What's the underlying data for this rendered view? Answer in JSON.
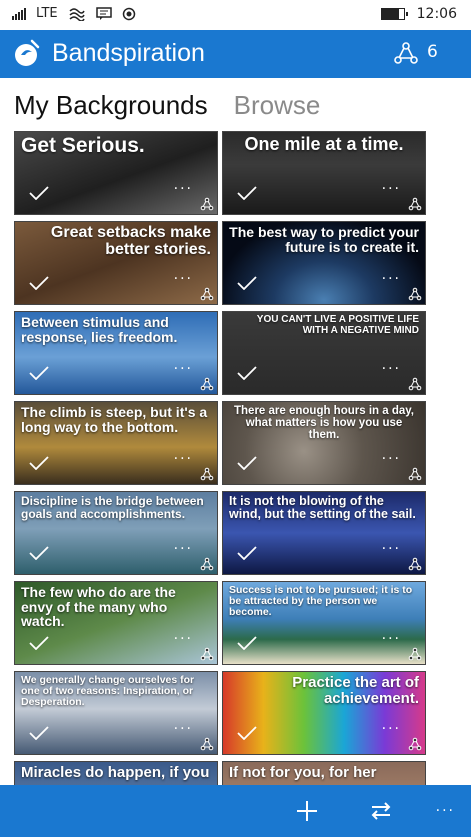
{
  "status_bar": {
    "network": "LTE",
    "time": "12:06",
    "battery_level": 0.8,
    "icons": [
      "signal-icon",
      "lte-label",
      "wifi-icon",
      "message-icon",
      "record-icon",
      "battery-icon"
    ]
  },
  "app_bar": {
    "title": "Bandspiration",
    "shared_count": "6",
    "accent": "#1a78d0"
  },
  "tabs": [
    {
      "label": "My Backgrounds",
      "active": true
    },
    {
      "label": "Browse",
      "active": false
    }
  ],
  "backgrounds": [
    {
      "quote": "Get Serious.",
      "bg": "linear-gradient(160deg,#4a4a4a 0%,#1f1f1f 55%,#6a6a6a 100%)",
      "align": "left",
      "size": 21
    },
    {
      "quote": "One mile at a time.",
      "bg": "linear-gradient(180deg,#2b2b2b 0%,#3b3b3b 40%,#1a1a1a 100%)",
      "align": "center",
      "size": 18
    },
    {
      "quote": "Great setbacks make better stories.",
      "bg": "linear-gradient(160deg,#7b5a3c 0%,#4d3421 50%,#8d6a48 100%)",
      "align": "right",
      "size": 16
    },
    {
      "quote": "The best way to predict your future is to create it.",
      "bg": "radial-gradient(ellipse at 50% 95%,#4a7fb2 0%,#1d3a62 35%,#050a16 75%)",
      "align": "right",
      "size": 14
    },
    {
      "quote": "Between stimulus and response, lies freedom.",
      "bg": "linear-gradient(180deg,#2f6db6 0%,#6ba0d6 55%,#23589a 100%)",
      "align": "left",
      "size": 14
    },
    {
      "quote": "YOU CAN'T LIVE A POSITIVE LIFE WITH A NEGATIVE MIND",
      "bg": "linear-gradient(180deg,#3a3a3a 0%,#2a2a2a 100%)",
      "align": "right",
      "size": 10
    },
    {
      "quote": "The climb is steep, but it's a long way to the bottom.",
      "bg": "linear-gradient(180deg,#5a4e3a 0%,#b08a3c 55%,#3a2e1e 100%)",
      "align": "left",
      "size": 14
    },
    {
      "quote": "There are enough hours in a day, what matters is how you use them.",
      "bg": "radial-gradient(circle at 40% 60%,#9a9186 0%,#5e564d 45%,#3a342e 100%)",
      "align": "center",
      "size": 11.5
    },
    {
      "quote": "Discipline is the bridge between goals and accomplishments.",
      "bg": "linear-gradient(180deg,#5d7ea0 0%,#7f9fb8 45%,#2e5f6c 100%)",
      "align": "left",
      "size": 12
    },
    {
      "quote": "It is not the blowing of the wind, but the setting of the sail.",
      "bg": "linear-gradient(180deg,#1c2a6a 0%,#3b56b0 50%,#0e1844 100%)",
      "align": "left",
      "size": 12.5
    },
    {
      "quote": "The few who do are the envy of the many who watch.",
      "bg": "linear-gradient(160deg,#2f5a2a 0%,#5e8a4a 50%,#a9c4d6 100%)",
      "align": "left",
      "size": 14
    },
    {
      "quote": "Success is not to be pursued; it is to be attracted by the person we become.",
      "bg": "linear-gradient(180deg,#6fa9de 0%,#3e7fb8 45%,#2c6a4a 70%,#e8e0c8 100%)",
      "align": "left",
      "size": 10.5
    },
    {
      "quote": "We generally change ourselves for one of two reasons: Inspiration, or Desperation.",
      "bg": "linear-gradient(180deg,#7b8fa8 0%,#c3cbd6 45%,#465a74 100%)",
      "align": "left",
      "size": 10.5
    },
    {
      "quote": "Practice the art of achievement.",
      "bg": "linear-gradient(90deg,#d63a2a 0%,#e8b21a 20%,#6cc23a 40%,#1aa6d6 60%,#7a3ad6 80%,#d63a8a 100%)",
      "align": "right",
      "size": 15
    },
    {
      "quote": "Miracles do happen, if you",
      "bg": "linear-gradient(180deg,#3a5a8a 0%,#7c9dc4 100%)",
      "align": "left",
      "size": 15
    },
    {
      "quote": "If not for you, for her",
      "bg": "linear-gradient(180deg,#8a6a5a 0%,#c49b7c 100%)",
      "align": "left",
      "size": 15
    }
  ],
  "card_actions": {
    "more_label": "···"
  },
  "command_bar": {
    "buttons": [
      "add-icon",
      "swap-icon"
    ],
    "more_label": "···"
  }
}
